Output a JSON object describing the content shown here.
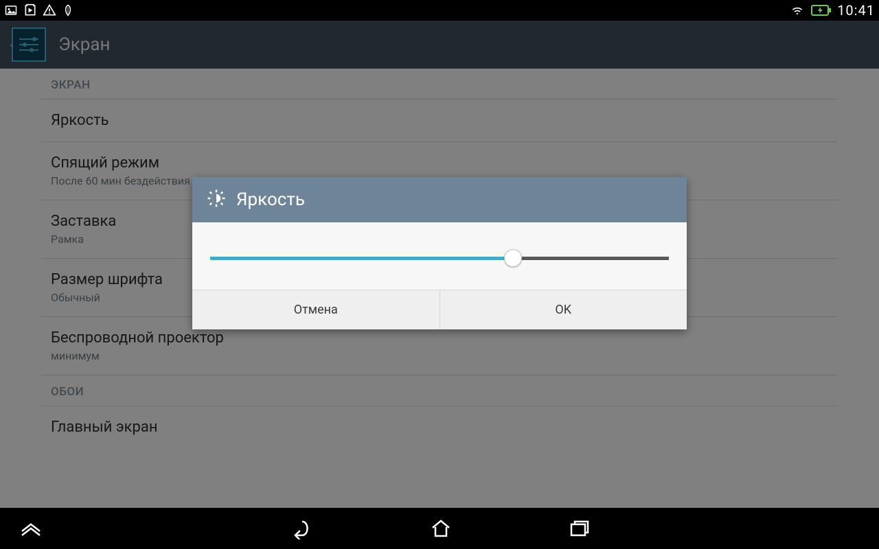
{
  "status_bar": {
    "time": "10:41"
  },
  "action_bar": {
    "title": "Экран"
  },
  "sections": {
    "screen_header": "ЭКРАН",
    "brightness": "Яркость",
    "sleep": {
      "title": "Спящий режим",
      "sub": "После 60 мин бездействия"
    },
    "daydream": {
      "title": "Заставка",
      "sub": "Рамка"
    },
    "font": {
      "title": "Размер шрифта",
      "sub": "Обычный"
    },
    "wireless": {
      "title": "Беспроводной проектор",
      "sub": "минимум"
    },
    "wallpaper_header": "ОБОИ",
    "home": "Главный экран"
  },
  "dialog": {
    "title": "Яркость",
    "slider_percent": 66,
    "cancel": "Отмена",
    "ok": "OK"
  }
}
